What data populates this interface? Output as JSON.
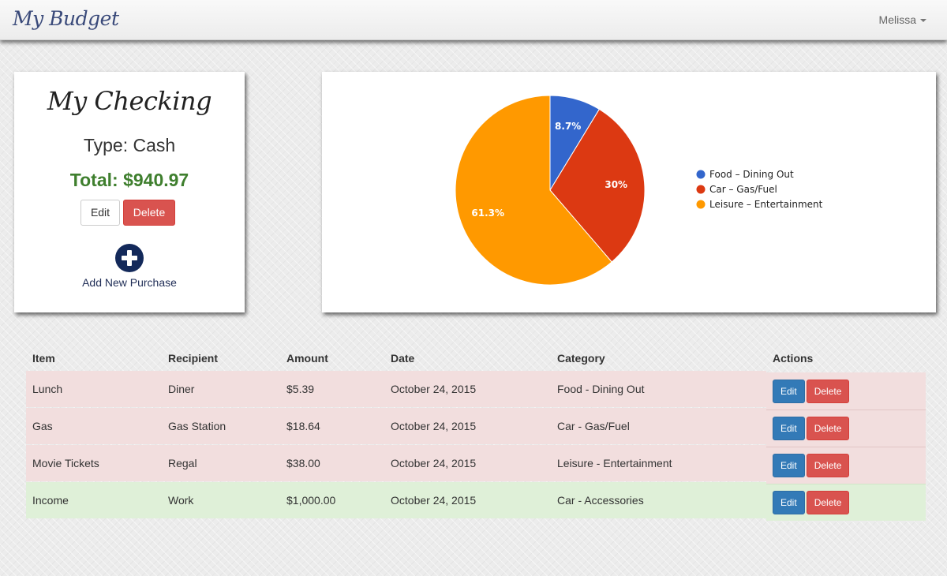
{
  "navbar": {
    "brand": "My Budget",
    "user": "Melissa"
  },
  "account": {
    "title": "My Checking",
    "type": "Type: Cash",
    "total": "Total: $940.97",
    "edit_label": "Edit",
    "delete_label": "Delete",
    "add_icon": "plus-circle-icon",
    "add_label": "Add New Purchase"
  },
  "chart_data": {
    "type": "pie",
    "title": "",
    "slices": [
      {
        "label": "Food – Dining Out",
        "value": 8.7,
        "display": "8.7%",
        "color": "#3366cc"
      },
      {
        "label": "Car – Gas/Fuel",
        "value": 30,
        "display": "30%",
        "color": "#dc3912"
      },
      {
        "label": "Leisure – Entertainment",
        "value": 61.3,
        "display": "61.3%",
        "color": "#ff9900"
      }
    ],
    "legend_position": "right"
  },
  "table": {
    "columns": [
      "Item",
      "Recipient",
      "Amount",
      "Date",
      "Category",
      "Actions"
    ],
    "edit_label": "Edit",
    "delete_label": "Delete",
    "rows": [
      {
        "item": "Lunch",
        "recipient": "Diner",
        "amount": "$5.39",
        "date": "October 24, 2015",
        "category": "Food - Dining Out",
        "status": "danger"
      },
      {
        "item": "Gas",
        "recipient": "Gas Station",
        "amount": "$18.64",
        "date": "October 24, 2015",
        "category": "Car - Gas/Fuel",
        "status": "danger"
      },
      {
        "item": "Movie Tickets",
        "recipient": "Regal",
        "amount": "$38.00",
        "date": "October 24, 2015",
        "category": "Leisure - Entertainment",
        "status": "danger"
      },
      {
        "item": "Income",
        "recipient": "Work",
        "amount": "$1,000.00",
        "date": "October 24, 2015",
        "category": "Car - Accessories",
        "status": "success"
      }
    ]
  },
  "colors": {
    "brand": "#3a4a7a",
    "total": "#3f7f2e",
    "primary": "#337ab7",
    "danger": "#d9534f",
    "row_danger": "#f2dede",
    "row_success": "#dff0d8"
  }
}
